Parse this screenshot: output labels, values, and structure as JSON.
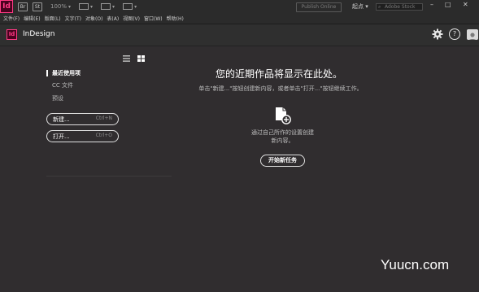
{
  "appbar": {
    "logo": "Id",
    "btn_bridge": "Br",
    "btn_stock": "St",
    "zoom": "100%",
    "publish": "Publish Online",
    "workspace": "起点",
    "stock_search_placeholder": "Adobe Stock",
    "minimize": "–",
    "maximize": "□",
    "close": "✕"
  },
  "menu": {
    "file": "文件(F)",
    "edit": "编辑(E)",
    "layout": "版面(L)",
    "type": "文字(T)",
    "object": "对象(O)",
    "table": "表(A)",
    "view": "视图(V)",
    "window": "窗口(W)",
    "help": "帮助(H)"
  },
  "home": {
    "logo": "Id",
    "title": "InDesign"
  },
  "sidebar": {
    "recent": "最近使用项",
    "cc_files": "CC 文件",
    "presets": "预设",
    "new_label": "新建...",
    "new_shortcut": "Ctrl+N",
    "open_label": "打开...",
    "open_shortcut": "Ctrl+O"
  },
  "main": {
    "heading": "您的近期作品将显示在此处。",
    "subtext": "单击\"新建...\"按钮创建新内容，或者单击\"打开...\"按钮继续工作。",
    "desc_line1": "通过自己所作的设置创建",
    "desc_line2": "新内容。",
    "start_button": "开始新任务"
  },
  "watermark": "Yuucn.com",
  "colors": {
    "background": "#302d2f",
    "brand_pink": "#ff3a85",
    "brand_dark": "#49021f"
  }
}
